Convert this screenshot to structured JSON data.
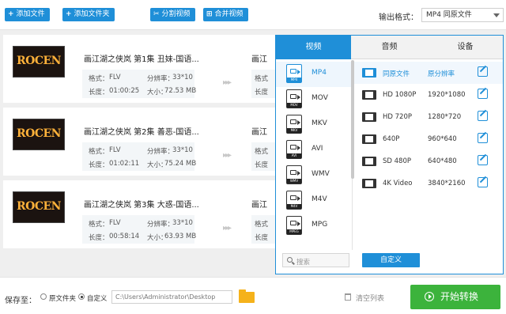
{
  "toolbar": {
    "add_file": "添加文件",
    "add_folder": "添加文件夹",
    "split_video": "分割视频",
    "merge_video": "合并视频",
    "output_format_label": "输出格式：",
    "output_format_value": "MP4  同原文件"
  },
  "files": [
    {
      "thumb_text": "ROCEN",
      "title": "画江湖之侠岚 第1集 丑妹-国语...",
      "format_label": "格式：",
      "format": "FLV",
      "resolution_label": "分辨率：",
      "resolution": "33*10",
      "duration_label": "长度：",
      "duration": "01:00:25",
      "size_label": "大小：",
      "size": "72.53 MB",
      "out_title": "画江",
      "out_format_label": "格式",
      "out_duration_label": "长度"
    },
    {
      "thumb_text": "ROCEN",
      "title": "画江湖之侠岚 第2集 善恶-国语...",
      "format_label": "格式：",
      "format": "FLV",
      "resolution_label": "分辨率：",
      "resolution": "33*10",
      "duration_label": "长度：",
      "duration": "01:02:11",
      "size_label": "大小：",
      "size": "75.24 MB",
      "out_title": "画江",
      "out_format_label": "格式",
      "out_duration_label": "长度"
    },
    {
      "thumb_text": "ROCEN",
      "title": "画江湖之侠岚 第3集 大惑-国语...",
      "format_label": "格式：",
      "format": "FLV",
      "resolution_label": "分辨率：",
      "resolution": "33*10",
      "duration_label": "长度：",
      "duration": "00:58:14",
      "size_label": "大小：",
      "size": "63.93 MB",
      "out_title": "画江",
      "out_format_label": "格式",
      "out_duration_label": "长度"
    }
  ],
  "popup": {
    "tabs": [
      "视频",
      "音频",
      "设备"
    ],
    "formats": [
      {
        "name": "MP4",
        "band": "MP4"
      },
      {
        "name": "MOV",
        "band": "MOV"
      },
      {
        "name": "MKV",
        "band": "MKV"
      },
      {
        "name": "AVI",
        "band": "AVI"
      },
      {
        "name": "WMV",
        "band": "WMV"
      },
      {
        "name": "M4V",
        "band": "M4V"
      },
      {
        "name": "MPG",
        "band": "MPEG"
      }
    ],
    "presets": [
      {
        "name": "同原文件",
        "resolution": "原分辨率"
      },
      {
        "name": "HD 1080P",
        "resolution": "1920*1080"
      },
      {
        "name": "HD 720P",
        "resolution": "1280*720"
      },
      {
        "name": "640P",
        "resolution": "960*640"
      },
      {
        "name": "SD 480P",
        "resolution": "640*480"
      },
      {
        "name": "4K Video",
        "resolution": "3840*2160"
      }
    ],
    "search_placeholder": "搜索",
    "custom_button": "自定义"
  },
  "bottom": {
    "save_to": "保存至：",
    "opt_source": "原文件夹",
    "opt_custom": "自定义",
    "path": "C:\\Users\\Administrator\\Desktop",
    "clear_list": "清空列表",
    "convert": "开始转换"
  },
  "colors": {
    "accent": "#1f8fd8",
    "convert": "#3cb33c",
    "folder": "#f5b21b"
  }
}
